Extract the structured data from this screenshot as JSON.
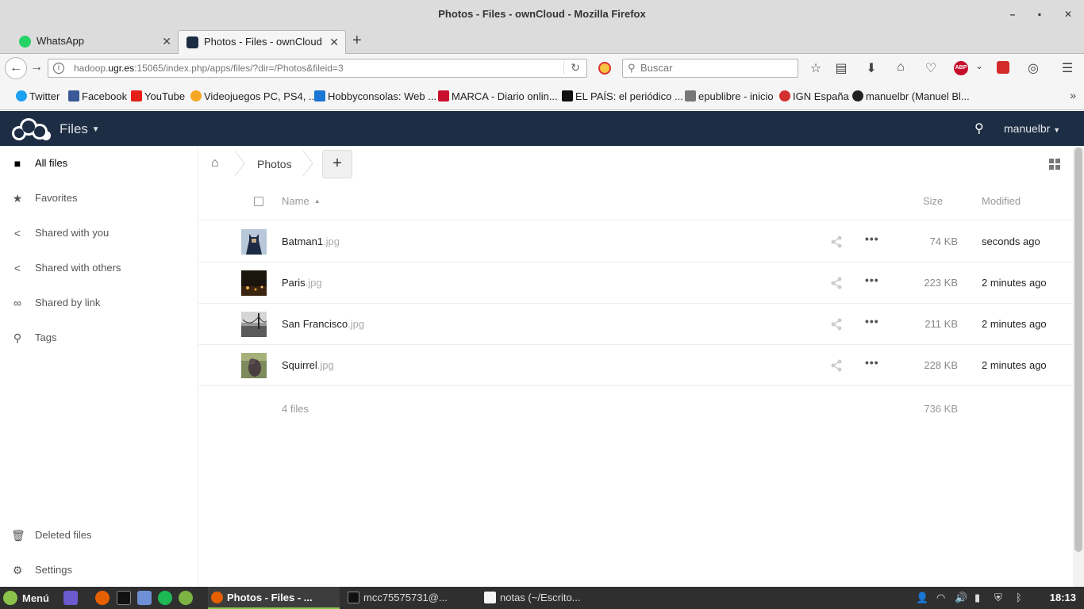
{
  "window": {
    "title": "Photos - Files - ownCloud - Mozilla Firefox"
  },
  "tabs": [
    {
      "label": "WhatsApp",
      "active": false
    },
    {
      "label": "Photos - Files - ownCloud",
      "active": true
    }
  ],
  "navbar": {
    "url_prefix": "hadoop.",
    "url_domain": "ugr.es",
    "url_rest": ":15065/index.php/apps/files/?dir=/Photos&fileid=3",
    "search_placeholder": "Buscar",
    "abp_label": "ABP"
  },
  "bookmarks": [
    {
      "label": "Twitter",
      "color": "#1da1f2"
    },
    {
      "label": "Facebook",
      "color": "#3b5998"
    },
    {
      "label": "YouTube",
      "color": "#e62117"
    },
    {
      "label": "Videojuegos PC, PS4, ...",
      "color": "#f5a623"
    },
    {
      "label": "Hobbyconsolas: Web ...",
      "color": "#1976d2"
    },
    {
      "label": "MARCA - Diario onlin...",
      "color": "#c8102e"
    },
    {
      "label": "EL PAÍS: el periódico ...",
      "color": "#111111"
    },
    {
      "label": "epublibre - inicio",
      "color": "#555555"
    },
    {
      "label": "IGN España",
      "color": "#d32f2f"
    },
    {
      "label": "manuelbr (Manuel Bl...",
      "color": "#222222"
    }
  ],
  "oc": {
    "app_name": "Files",
    "user": "manuelbr",
    "accent": "#1d2d44"
  },
  "sidebar": {
    "items": [
      {
        "label": "All files",
        "icon": "folder-icon"
      },
      {
        "label": "Favorites",
        "icon": "star-icon"
      },
      {
        "label": "Shared with you",
        "icon": "share-icon"
      },
      {
        "label": "Shared with others",
        "icon": "share-icon"
      },
      {
        "label": "Shared by link",
        "icon": "link-icon"
      },
      {
        "label": "Tags",
        "icon": "search-icon"
      }
    ],
    "bottom": [
      {
        "label": "Deleted files",
        "icon": "trash-icon"
      },
      {
        "label": "Settings",
        "icon": "gear-icon"
      }
    ]
  },
  "breadcrumb": {
    "folder": "Photos",
    "new_label": "+"
  },
  "table": {
    "headers": {
      "name": "Name",
      "size": "Size",
      "modified": "Modified"
    },
    "rows": [
      {
        "base": "Batman1",
        "ext": ".jpg",
        "size": "74 KB",
        "modified": "seconds ago"
      },
      {
        "base": "Paris",
        "ext": ".jpg",
        "size": "223 KB",
        "modified": "2 minutes ago"
      },
      {
        "base": "San Francisco",
        "ext": ".jpg",
        "size": "211 KB",
        "modified": "2 minutes ago"
      },
      {
        "base": "Squirrel",
        "ext": ".jpg",
        "size": "228 KB",
        "modified": "2 minutes ago"
      }
    ],
    "summary": {
      "count": "4 files",
      "total": "736 KB"
    }
  },
  "taskbar": {
    "menu": "Menú",
    "tasks": [
      {
        "label": "Photos - Files - ...",
        "active": true
      },
      {
        "label": "mcc75575731@...",
        "active": false
      },
      {
        "label": "notas (~/Escrito...",
        "active": false
      }
    ],
    "clock": "18:13"
  }
}
